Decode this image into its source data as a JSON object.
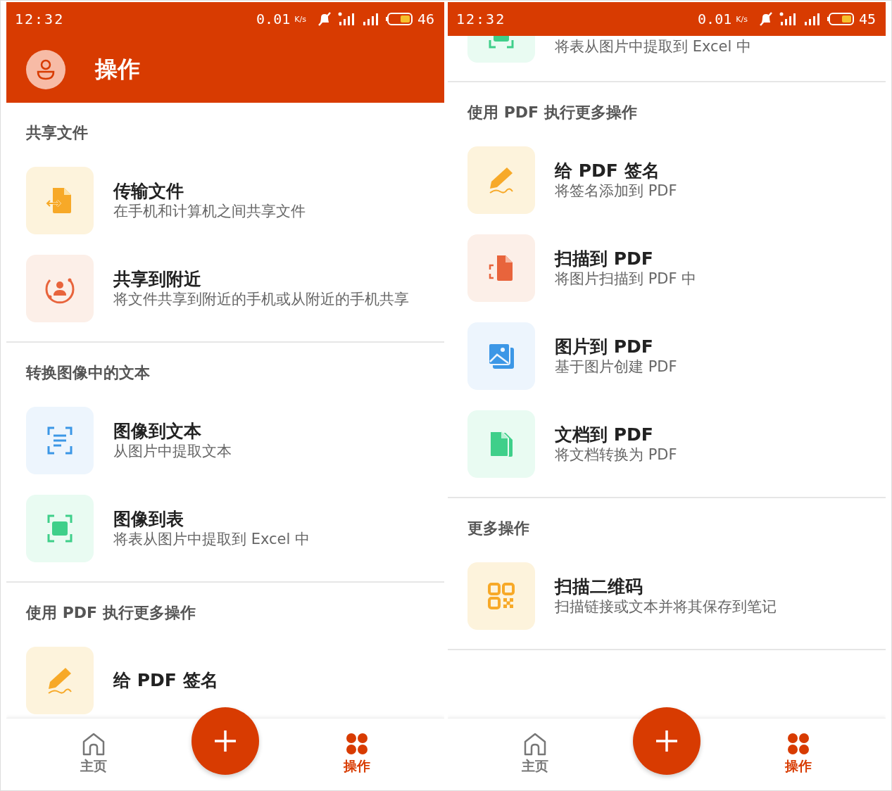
{
  "screens": [
    {
      "status_bar": {
        "time": "12:32",
        "speed": "0.01",
        "speed_unit": "K/s",
        "battery": "46"
      },
      "header": {
        "title": "操作"
      },
      "sections": [
        {
          "title": "共享文件",
          "items": [
            {
              "kind": "transfer",
              "title": "传输文件",
              "subtitle": "在手机和计算机之间共享文件"
            },
            {
              "kind": "nearby",
              "title": "共享到附近",
              "subtitle": "将文件共享到附近的手机或从附近的手机共享"
            }
          ]
        },
        {
          "title": "转换图像中的文本",
          "items": [
            {
              "kind": "text-scan",
              "title": "图像到文本",
              "subtitle": "从图片中提取文本"
            },
            {
              "kind": "table-scan",
              "title": "图像到表",
              "subtitle": "将表从图片中提取到 Excel 中"
            }
          ]
        },
        {
          "title": "使用 PDF 执行更多操作",
          "items": [
            {
              "kind": "sign",
              "title": "给 PDF 签名"
            }
          ]
        }
      ],
      "nav": {
        "items": [
          {
            "kind": "home",
            "label": "主页",
            "selected": false
          },
          {
            "kind": "apps",
            "label": "操作",
            "selected": true
          }
        ]
      }
    },
    {
      "status_bar": {
        "time": "12:32",
        "speed": "0.01",
        "speed_unit": "K/s",
        "battery": "45"
      },
      "sections": [
        {
          "items": [
            {
              "kind": "table-scan",
              "subtitle": "将表从图片中提取到 Excel 中"
            }
          ]
        },
        {
          "title": "使用 PDF 执行更多操作",
          "items": [
            {
              "kind": "sign",
              "title": "给 PDF 签名",
              "subtitle": "将签名添加到 PDF"
            },
            {
              "kind": "scan",
              "title": "扫描到 PDF",
              "subtitle": "将图片扫描到 PDF 中"
            },
            {
              "kind": "image",
              "title": "图片到 PDF",
              "subtitle": "基于图片创建 PDF"
            },
            {
              "kind": "doc",
              "title": "文档到 PDF",
              "subtitle": "将文档转换为 PDF"
            }
          ]
        },
        {
          "title": "更多操作",
          "items": [
            {
              "kind": "qr",
              "title": "扫描二维码",
              "subtitle": "扫描链接或文本并将其保存到笔记"
            }
          ]
        }
      ],
      "nav": {
        "items": [
          {
            "kind": "home",
            "label": "主页",
            "selected": false
          },
          {
            "kind": "apps",
            "label": "操作",
            "selected": true
          }
        ]
      }
    }
  ]
}
